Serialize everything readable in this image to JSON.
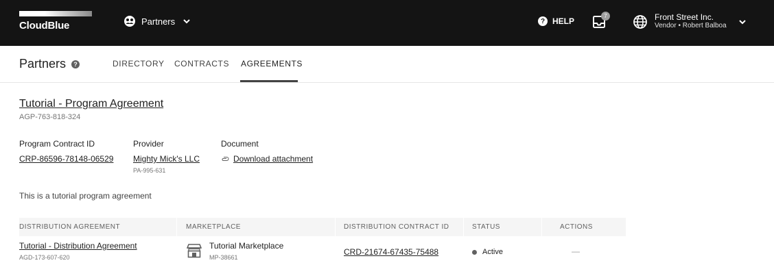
{
  "topbar": {
    "logo_text": "CloudBlue",
    "module_label": "Partners",
    "help_label": "HELP",
    "notification_count": "7",
    "account_name": "Front Street Inc.",
    "account_sub": "Vendor • Robert Balboa"
  },
  "subheader": {
    "title": "Partners",
    "tabs": [
      {
        "label": "DIRECTORY",
        "active": false
      },
      {
        "label": "CONTRACTS",
        "active": false
      },
      {
        "label": "AGREEMENTS",
        "active": true
      }
    ]
  },
  "agreement": {
    "title": "Tutorial - Program Agreement",
    "id": "AGP-763-818-324",
    "fields": {
      "program_contract": {
        "label": "Program Contract ID",
        "value": "CRP-86596-78148-06529"
      },
      "provider": {
        "label": "Provider",
        "value": "Mighty Mick's LLC",
        "sub": "PA-995-631"
      },
      "document": {
        "label": "Document",
        "value": "Download attachment"
      }
    },
    "description": "This is a tutorial program agreement"
  },
  "table": {
    "headers": {
      "distribution_agreement": "DISTRIBUTION AGREEMENT",
      "marketplace": "MARKETPLACE",
      "distribution_contract_id": "DISTRIBUTION CONTRACT ID",
      "status": "STATUS",
      "actions": "ACTIONS"
    },
    "rows": [
      {
        "agreement_name": "Tutorial - Distribution Agreement",
        "agreement_id": "AGD-173-607-620",
        "marketplace_name": "Tutorial Marketplace",
        "marketplace_id": "MP-38661",
        "contract_id": "CRD-21674-67435-75488",
        "status": "Active",
        "actions": "—"
      }
    ]
  },
  "colors": {
    "topbar_bg": "#141414",
    "text_primary": "#212121",
    "text_secondary": "#757575",
    "table_header_bg": "#f5f5f5"
  }
}
